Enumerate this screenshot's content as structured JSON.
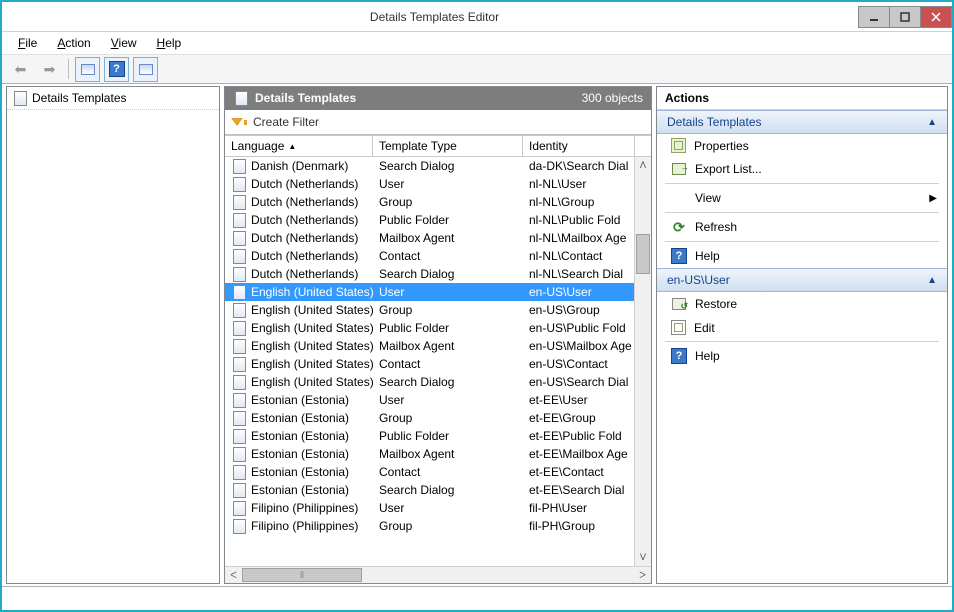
{
  "window": {
    "title": "Details Templates Editor"
  },
  "menu": {
    "file": "File",
    "action": "Action",
    "view": "View",
    "help": "Help"
  },
  "left": {
    "root": "Details Templates"
  },
  "center": {
    "title": "Details Templates",
    "object_count": "300 objects",
    "create_filter": "Create Filter",
    "columns": {
      "language": "Language",
      "template_type": "Template Type",
      "identity": "Identity"
    },
    "rows": [
      {
        "language": "Danish (Denmark)",
        "type": "Search Dialog",
        "identity": "da-DK\\Search Dialog",
        "selected": false
      },
      {
        "language": "Dutch (Netherlands)",
        "type": "User",
        "identity": "nl-NL\\User",
        "selected": false
      },
      {
        "language": "Dutch (Netherlands)",
        "type": "Group",
        "identity": "nl-NL\\Group",
        "selected": false
      },
      {
        "language": "Dutch (Netherlands)",
        "type": "Public Folder",
        "identity": "nl-NL\\Public Folder",
        "selected": false
      },
      {
        "language": "Dutch (Netherlands)",
        "type": "Mailbox Agent",
        "identity": "nl-NL\\Mailbox Agent",
        "selected": false
      },
      {
        "language": "Dutch (Netherlands)",
        "type": "Contact",
        "identity": "nl-NL\\Contact",
        "selected": false
      },
      {
        "language": "Dutch (Netherlands)",
        "type": "Search Dialog",
        "identity": "nl-NL\\Search Dialog",
        "selected": false
      },
      {
        "language": "English (United States)",
        "type": "User",
        "identity": "en-US\\User",
        "selected": true
      },
      {
        "language": "English (United States)",
        "type": "Group",
        "identity": "en-US\\Group",
        "selected": false
      },
      {
        "language": "English (United States)",
        "type": "Public Folder",
        "identity": "en-US\\Public Folder",
        "selected": false
      },
      {
        "language": "English (United States)",
        "type": "Mailbox Agent",
        "identity": "en-US\\Mailbox Agent",
        "selected": false
      },
      {
        "language": "English (United States)",
        "type": "Contact",
        "identity": "en-US\\Contact",
        "selected": false
      },
      {
        "language": "English (United States)",
        "type": "Search Dialog",
        "identity": "en-US\\Search Dialog",
        "selected": false
      },
      {
        "language": "Estonian (Estonia)",
        "type": "User",
        "identity": "et-EE\\User",
        "selected": false
      },
      {
        "language": "Estonian (Estonia)",
        "type": "Group",
        "identity": "et-EE\\Group",
        "selected": false
      },
      {
        "language": "Estonian (Estonia)",
        "type": "Public Folder",
        "identity": "et-EE\\Public Folder",
        "selected": false
      },
      {
        "language": "Estonian (Estonia)",
        "type": "Mailbox Agent",
        "identity": "et-EE\\Mailbox Agent",
        "selected": false
      },
      {
        "language": "Estonian (Estonia)",
        "type": "Contact",
        "identity": "et-EE\\Contact",
        "selected": false
      },
      {
        "language": "Estonian (Estonia)",
        "type": "Search Dialog",
        "identity": "et-EE\\Search Dialog",
        "selected": false
      },
      {
        "language": "Filipino (Philippines)",
        "type": "User",
        "identity": "fil-PH\\User",
        "selected": false
      },
      {
        "language": "Filipino (Philippines)",
        "type": "Group",
        "identity": "fil-PH\\Group",
        "selected": false
      }
    ]
  },
  "actions": {
    "header": "Actions",
    "section1": {
      "title": "Details Templates",
      "properties": "Properties",
      "export_list": "Export List...",
      "view": "View",
      "refresh": "Refresh",
      "help": "Help"
    },
    "section2": {
      "title": "en-US\\User",
      "restore": "Restore",
      "edit": "Edit",
      "help": "Help"
    }
  }
}
